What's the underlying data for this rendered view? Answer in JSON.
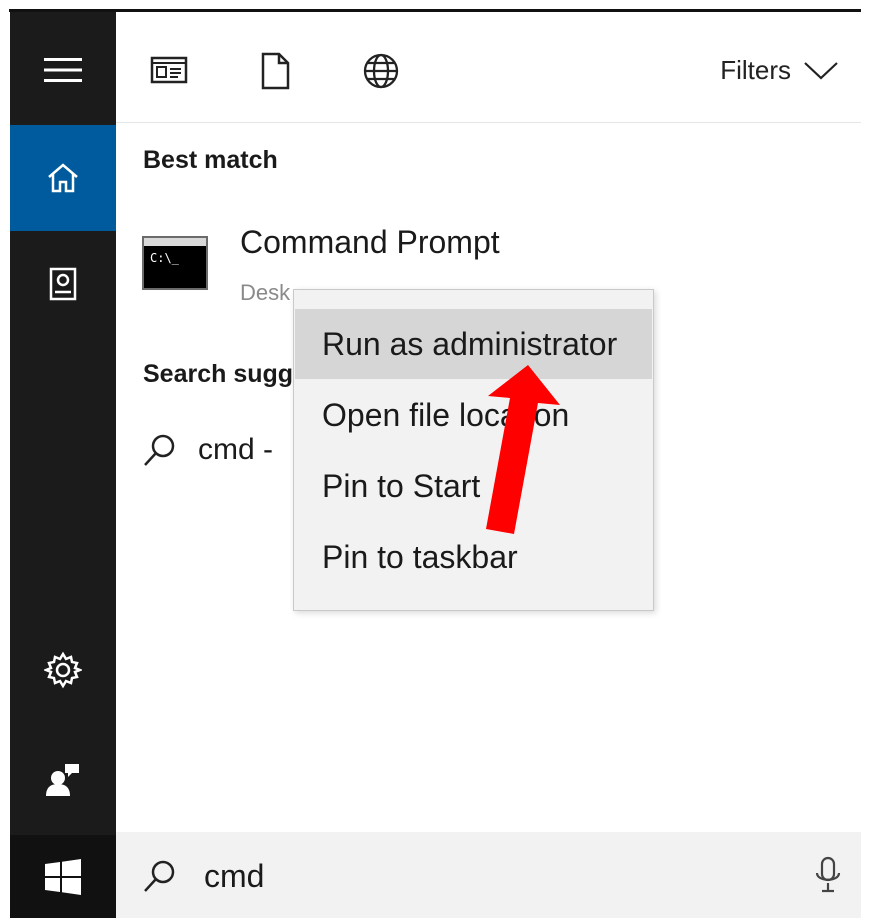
{
  "toolbar": {
    "icons": [
      "apps-icon",
      "document-icon",
      "web-icon"
    ],
    "filters_label": "Filters"
  },
  "rail": {
    "items": [
      "menu-icon",
      "home-icon",
      "documents-icon",
      "settings-icon",
      "feedback-icon",
      "windows-start-icon"
    ],
    "active": "home-icon",
    "colors": {
      "rail_bg": "#1b1b1b",
      "active_bg": "#005a9e"
    }
  },
  "results": {
    "best_match_title": "Best match",
    "app": {
      "name": "Command Prompt",
      "subtitle": "Desk",
      "icon_text": "C:\\_"
    },
    "suggestions_title": "Search sugg",
    "suggestion_text": "cmd -"
  },
  "context_menu": {
    "items": [
      {
        "label": "Run as administrator",
        "highlighted": true
      },
      {
        "label": "Open file location",
        "highlighted": false
      },
      {
        "label": "Pin to Start",
        "highlighted": false
      },
      {
        "label": "Pin to taskbar",
        "highlighted": false
      }
    ]
  },
  "search": {
    "query": "cmd"
  },
  "annotation": {
    "arrow_color": "#ff0000"
  }
}
